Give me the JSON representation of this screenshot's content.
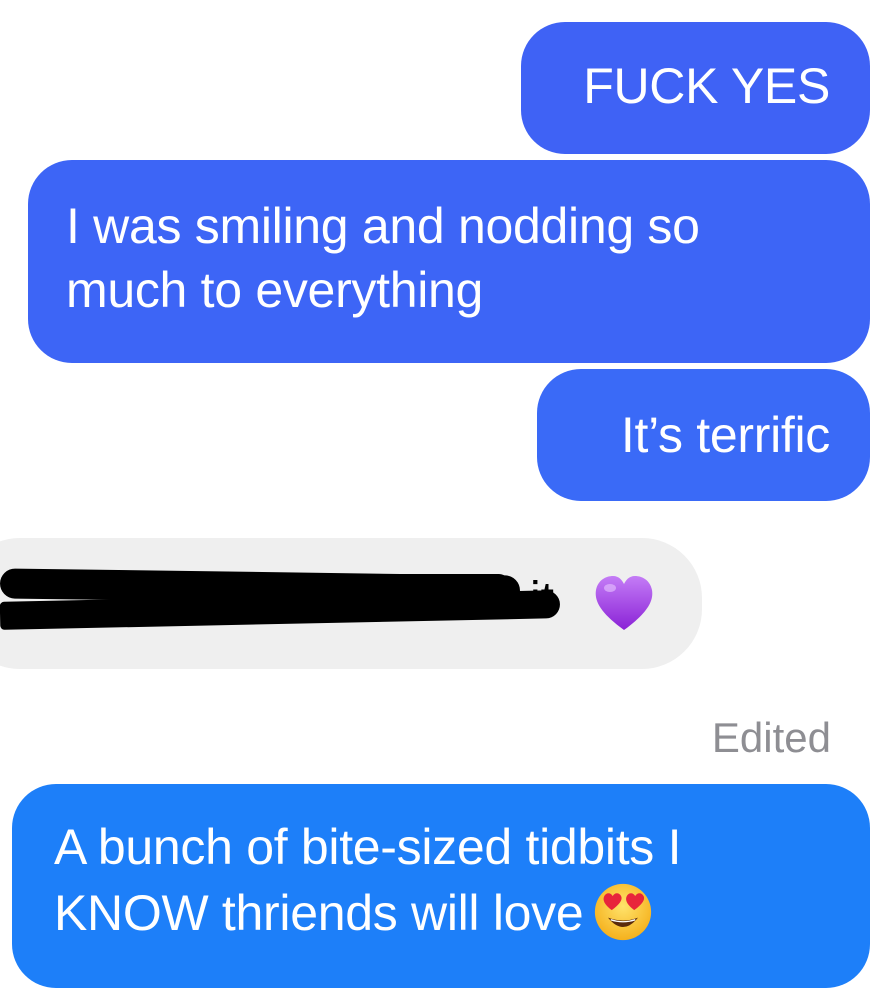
{
  "messages": {
    "sent_1": "FUCK YES",
    "sent_2": "I was smiling and nodding so much to everything",
    "sent_3": "It’s terrific",
    "received_1_visible_tail": "it",
    "edited_label": "Edited",
    "sent_4": "A bunch of bite-sized tidbits I KNOW thriends will love"
  },
  "icons": {
    "received_1_emoji": "purple-heart-emoji",
    "sent_4_emoji": "heart-eyes-emoji"
  },
  "colors": {
    "sent_bubble_top": "#3f62f5",
    "sent_bubble_bottom": "#1d7ff9",
    "received_bubble": "#efefef",
    "edited_text": "#8e8e93",
    "redaction": "#000000"
  }
}
